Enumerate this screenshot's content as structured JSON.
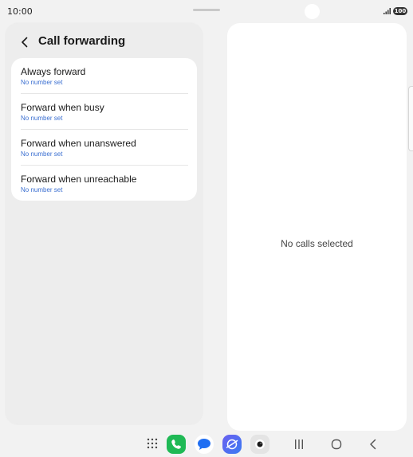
{
  "status_bar": {
    "time": "10:00",
    "battery": "100"
  },
  "header": {
    "title": "Call forwarding",
    "back_icon": "chevron-left-icon"
  },
  "forwarding_options": [
    {
      "title": "Always forward",
      "subtitle": "No number set"
    },
    {
      "title": "Forward when busy",
      "subtitle": "No number set"
    },
    {
      "title": "Forward when unanswered",
      "subtitle": "No number set"
    },
    {
      "title": "Forward when unreachable",
      "subtitle": "No number set"
    }
  ],
  "detail_pane": {
    "empty_message": "No calls selected"
  },
  "dock": {
    "apps": [
      "apps-grid-icon",
      "phone-app-icon",
      "messages-app-icon",
      "internet-app-icon",
      "camera-app-icon"
    ],
    "nav": [
      "recent-apps-icon",
      "home-icon",
      "back-icon"
    ]
  },
  "colors": {
    "accent_link": "#3b6fd1",
    "phone_app": "#1fb955",
    "background": "#f2f2f2"
  }
}
